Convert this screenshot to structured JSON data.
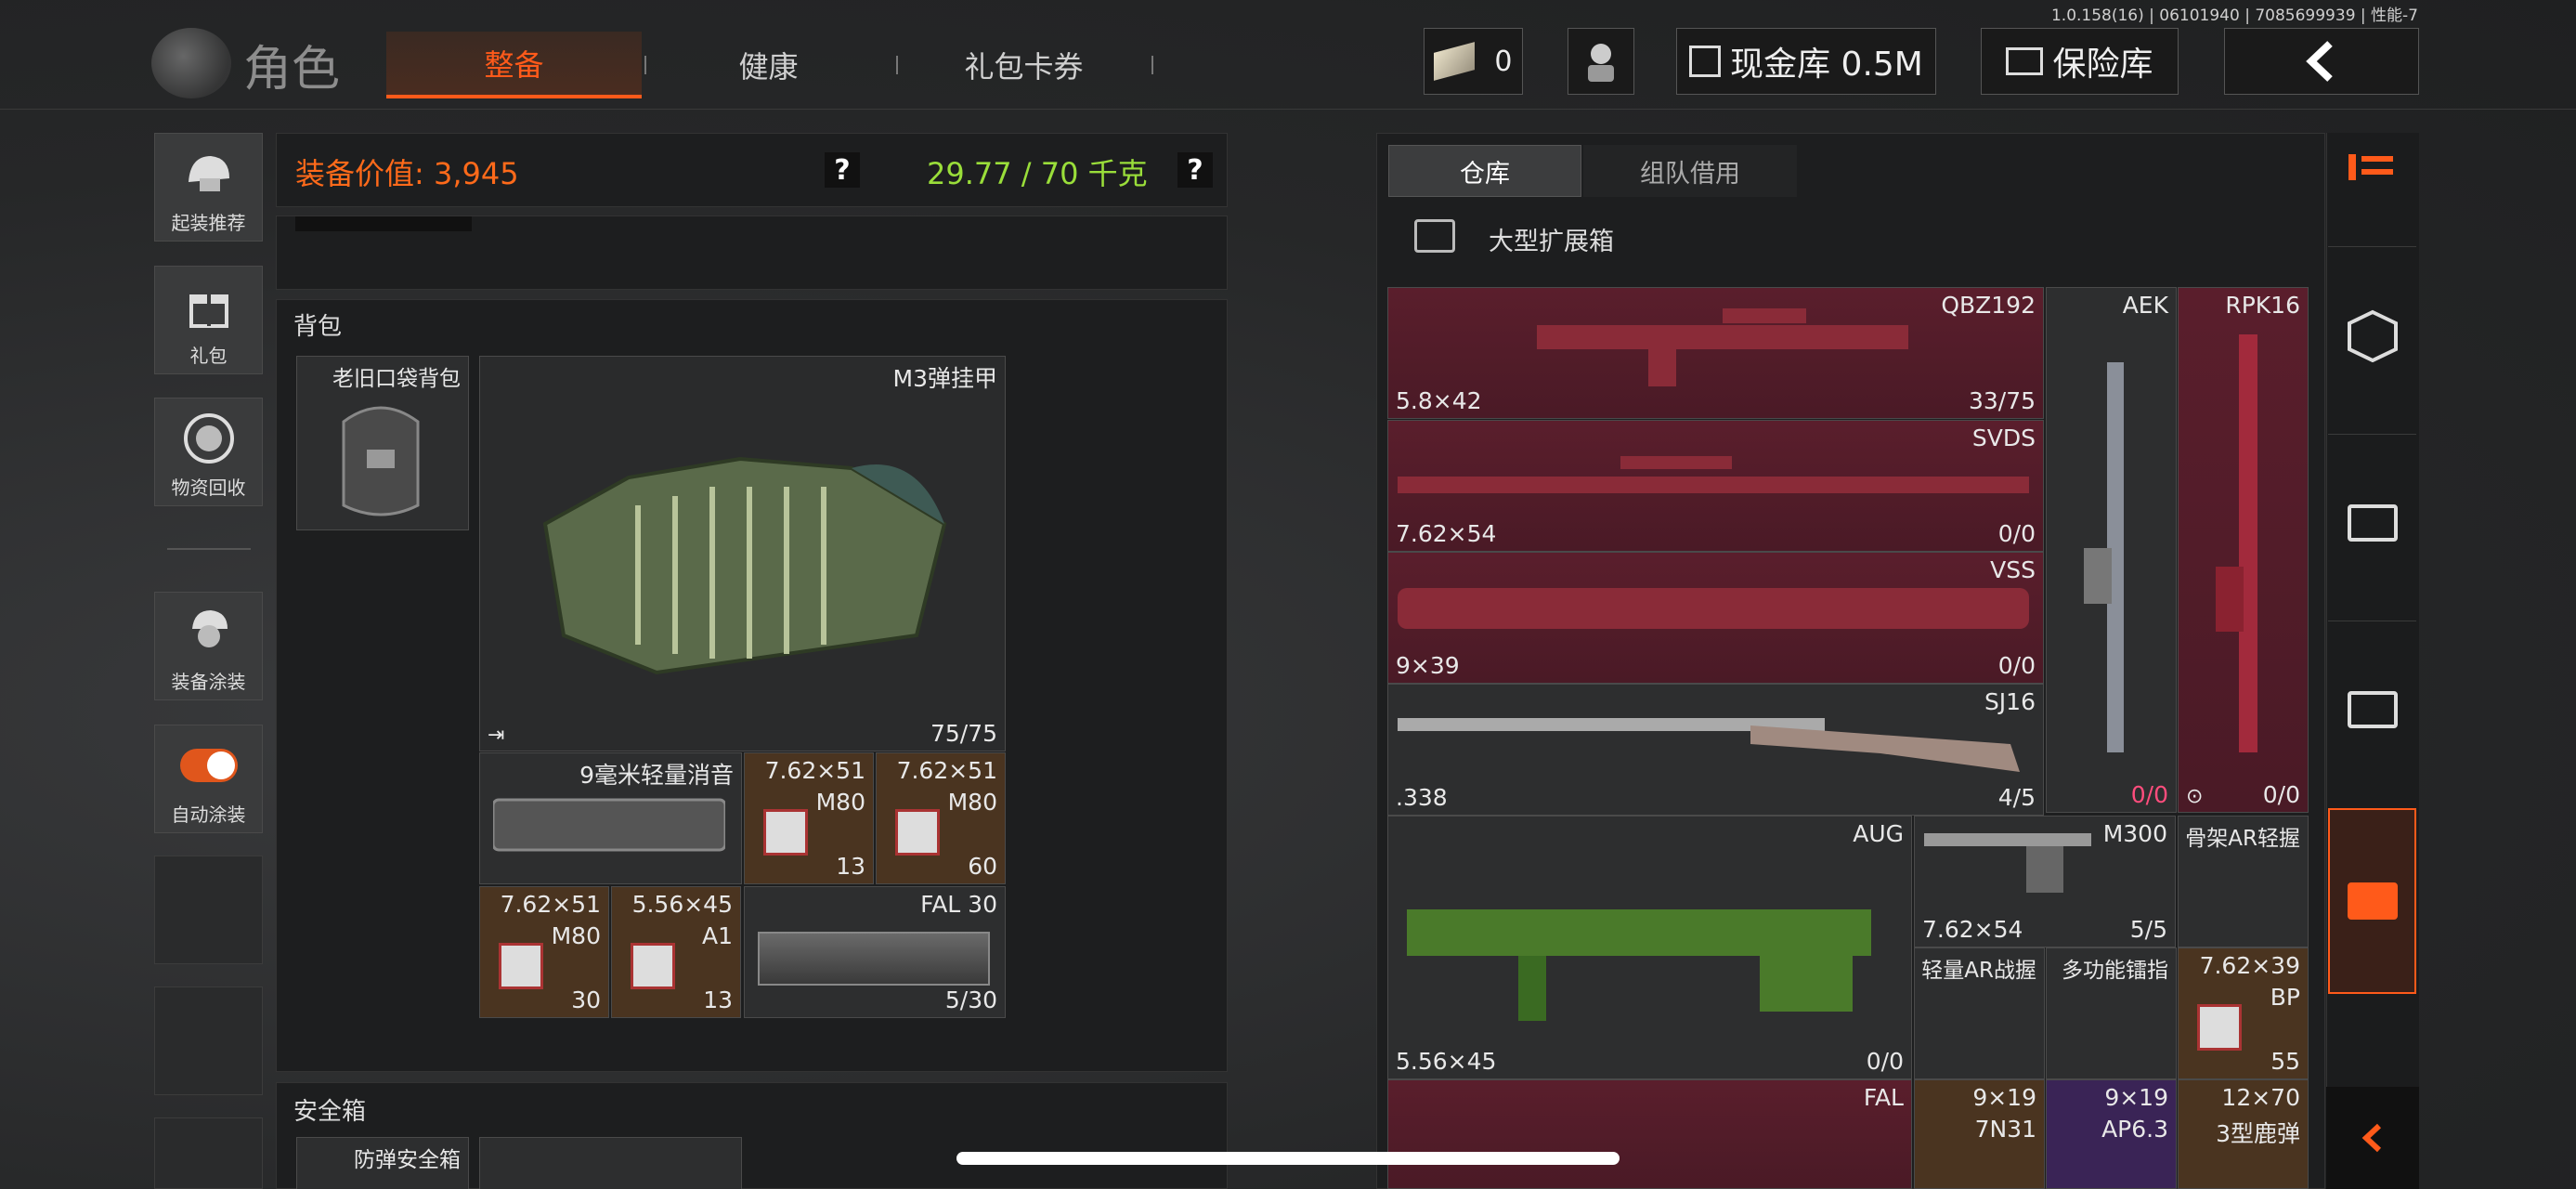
{
  "status": {
    "version": "1.0.158(16) | 06101940 | 7085699939 | 性能-7"
  },
  "header": {
    "title": "角色",
    "tabs": [
      "整备",
      "健康",
      "礼包卡券"
    ],
    "money": "0",
    "cash_vault": "现金库 0.5M",
    "safe_vault": "保险库"
  },
  "sidebar": [
    "起装推荐",
    "礼包",
    "物资回收",
    "装备涂装",
    "自动涂装"
  ],
  "stats": {
    "equip_value": "装备价值: 3,945",
    "weight": "29.77 / 70 千克",
    "help": "?"
  },
  "backpack": {
    "title": "背包",
    "bag_name": "老旧口袋背包",
    "vest": {
      "name": "M3弹挂甲",
      "count": "75/75"
    },
    "items": [
      {
        "name": "9毫米轻量消音"
      },
      {
        "name": "7.62×51",
        "sub": "M80",
        "count": "13"
      },
      {
        "name": "7.62×51",
        "sub": "M80",
        "count": "60"
      },
      {
        "name": "7.62×51",
        "sub": "M80",
        "count": "30"
      },
      {
        "name": "5.56×45",
        "sub": "A1",
        "count": "13"
      },
      {
        "name": "FAL 30",
        "count": "5/30"
      }
    ]
  },
  "safe_box": {
    "title": "安全箱",
    "item": "防弹安全箱"
  },
  "warehouse": {
    "tabs": [
      "仓库",
      "组队借用"
    ],
    "container": "大型扩展箱",
    "items": [
      {
        "name": "QBZ192",
        "caliber": "5.8×42",
        "count": "33/75"
      },
      {
        "name": "AEK",
        "count": ""
      },
      {
        "name": "RPK16",
        "count": "0/0"
      },
      {
        "name": "SVDS",
        "caliber": "7.62×54",
        "count": "0/0"
      },
      {
        "name": "VSS",
        "caliber": "9×39",
        "count": "0/0"
      },
      {
        "name": "SJ16",
        "caliber": ".338",
        "count": "4/5"
      },
      {
        "name": "AUG",
        "caliber": "5.56×45",
        "count": "0/0"
      },
      {
        "name": "M300",
        "caliber": "7.62×54",
        "count": "5/5"
      },
      {
        "name": "骨架AR轻握"
      },
      {
        "name": "轻量AR战握"
      },
      {
        "name": "多功能镭指"
      },
      {
        "name": "7.62×39",
        "sub": "BP",
        "count": "55"
      },
      {
        "name": "FAL"
      },
      {
        "name": "9×19",
        "sub": "7N31"
      },
      {
        "name": "9×19",
        "sub": "AP6.3"
      },
      {
        "name": "12×70",
        "sub": "3型鹿弹"
      }
    ],
    "aek_count": "0/0"
  }
}
